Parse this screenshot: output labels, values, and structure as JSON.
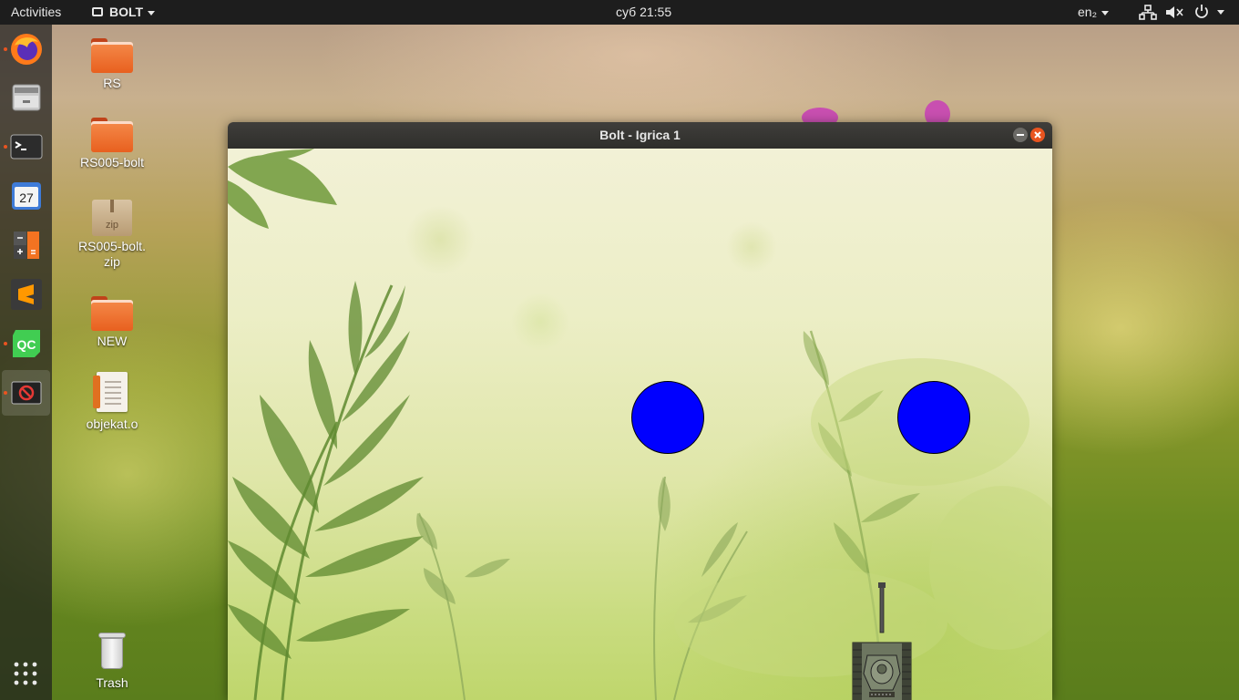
{
  "topbar": {
    "activities": "Activities",
    "app_name": "BOLT",
    "clock": "суб 21:55",
    "language": "en₂"
  },
  "dock": {
    "items": [
      {
        "name": "firefox"
      },
      {
        "name": "files"
      },
      {
        "name": "terminal"
      },
      {
        "name": "calendar",
        "text": "27"
      },
      {
        "name": "calculator"
      },
      {
        "name": "sublime-text"
      },
      {
        "name": "qt-creator",
        "text": "QC"
      },
      {
        "name": "bolt-game"
      }
    ]
  },
  "desktop": {
    "icons": [
      {
        "label": "RS",
        "type": "folder"
      },
      {
        "label": "RS005-bolt",
        "type": "folder"
      },
      {
        "label": "RS005-bolt.\nzip",
        "type": "zip",
        "badge": "zip"
      },
      {
        "label": "NEW",
        "type": "folder"
      },
      {
        "label": "objekat.o",
        "type": "file"
      },
      {
        "label": "Trash",
        "type": "trash"
      }
    ]
  },
  "window": {
    "title": "Bolt - Igrica 1"
  },
  "game": {
    "ball_color": "#0000ff",
    "balls": 2
  },
  "colors": {
    "topbar_bg": "#1d1d1d",
    "accent": "#e95420"
  }
}
